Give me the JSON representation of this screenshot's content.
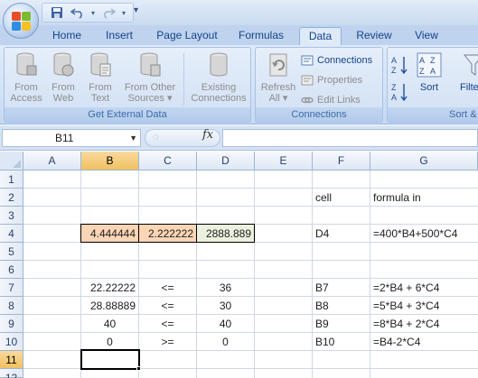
{
  "colors": {
    "accent": "#15428b",
    "selected_header": "#f1c15f",
    "input_fill": "#fbd5b5",
    "result_fill": "#ebf1de"
  },
  "quick_access": {
    "save_icon": "save-icon",
    "undo_icon": "undo-icon",
    "redo_icon": "redo-icon",
    "customize_icon": "dropdown-icon"
  },
  "tabs": [
    "Home",
    "Insert",
    "Page Layout",
    "Formulas",
    "Data",
    "Review",
    "View"
  ],
  "active_tab": "Data",
  "ribbon": {
    "get_external_data": {
      "label": "Get External Data",
      "buttons": [
        {
          "line1": "From",
          "line2": "Access"
        },
        {
          "line1": "From",
          "line2": "Web"
        },
        {
          "line1": "From",
          "line2": "Text"
        },
        {
          "line1": "From Other",
          "line2": "Sources ▾"
        },
        {
          "line1": "Existing",
          "line2": "Connections"
        }
      ]
    },
    "connections": {
      "label": "Connections",
      "refresh": {
        "line1": "Refresh",
        "line2": "All ▾"
      },
      "items": [
        "Connections",
        "Properties",
        "Edit Links"
      ]
    },
    "sort_filter": {
      "label": "Sort &",
      "sort": "Sort",
      "filter": "Filte"
    }
  },
  "formula_bar": {
    "name_box": "B11",
    "fx": "fx",
    "formula": ""
  },
  "sheet": {
    "columns": [
      "A",
      "B",
      "C",
      "D",
      "E",
      "F",
      "G"
    ],
    "rows": [
      "1",
      "2",
      "3",
      "4",
      "5",
      "6",
      "7",
      "8",
      "9",
      "10",
      "11",
      "12"
    ],
    "cells": {
      "F2": "cell",
      "G2": "formula in",
      "B4": "4.444444",
      "C4": "2.222222",
      "D4": "2888.889",
      "F4": "D4",
      "G4": "=400*B4+500*C4",
      "B7": "22.22222",
      "C7": "<=",
      "D7": "36",
      "F7": "B7",
      "G7": "=2*B4 + 6*C4",
      "B8": "28.88889",
      "C8": "<=",
      "D8": "30",
      "F8": "B8",
      "G8": "=5*B4 + 3*C4",
      "B9": "40",
      "C9": "<=",
      "D9": "40",
      "F9": "B9",
      "G9": "=8*B4 + 2*C4",
      "B10": "0",
      "C10": ">=",
      "D10": "0",
      "F10": "B10",
      "G10": "=B4-2*C4"
    }
  }
}
